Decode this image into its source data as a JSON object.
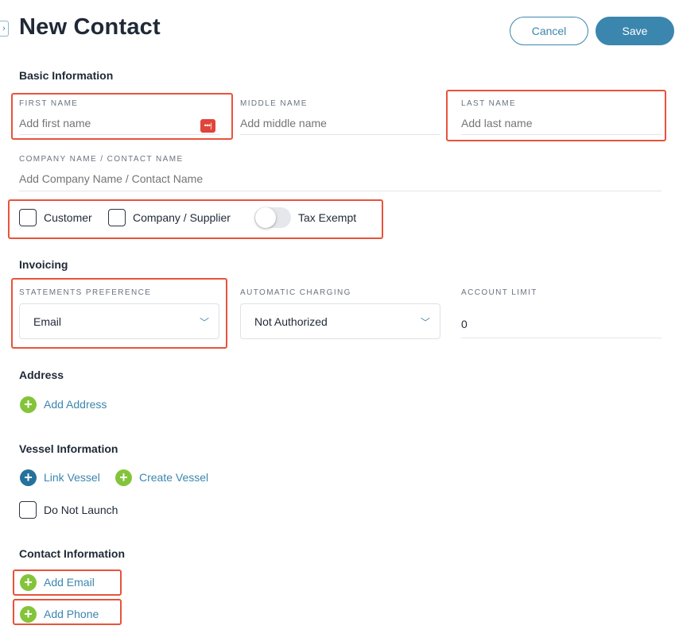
{
  "header": {
    "sidebar_toggle": "›",
    "title": "New Contact",
    "cancel_label": "Cancel",
    "save_label": "Save"
  },
  "basic_info": {
    "section_title": "Basic Information",
    "first_name": {
      "label": "FIRST NAME",
      "placeholder": "Add first name",
      "value": ""
    },
    "middle_name": {
      "label": "MIDDLE NAME",
      "placeholder": "Add middle name",
      "value": ""
    },
    "last_name": {
      "label": "LAST NAME",
      "placeholder": "Add last name",
      "value": ""
    },
    "company_name": {
      "label": "COMPANY NAME / CONTACT NAME",
      "placeholder": "Add Company Name / Contact Name",
      "value": ""
    },
    "password_manager_icon": "•••|",
    "options": {
      "customer": {
        "label": "Customer",
        "checked": false
      },
      "supplier": {
        "label": "Company / Supplier",
        "checked": false
      },
      "tax_exempt": {
        "label": "Tax Exempt",
        "on": false
      }
    }
  },
  "invoicing": {
    "section_title": "Invoicing",
    "statements_preference": {
      "label": "STATEMENTS PREFERENCE",
      "value": "Email"
    },
    "automatic_charging": {
      "label": "AUTOMATIC CHARGING",
      "value": "Not Authorized"
    },
    "account_limit": {
      "label": "ACCOUNT LIMIT",
      "value": "0"
    }
  },
  "address": {
    "section_title": "Address",
    "add_address_label": "Add Address"
  },
  "vessel": {
    "section_title": "Vessel Information",
    "link_vessel_label": "Link Vessel",
    "create_vessel_label": "Create Vessel",
    "do_not_launch": {
      "label": "Do Not Launch",
      "checked": false
    }
  },
  "contact_info": {
    "section_title": "Contact Information",
    "add_email_label": "Add Email",
    "add_phone_label": "Add Phone"
  },
  "icons": {
    "plus": "+",
    "chevron": "﹀"
  },
  "colors": {
    "accent": "#3b86ae",
    "add_green": "#84c43b",
    "link_blue": "#25719d",
    "highlight_red": "#e8533b"
  }
}
